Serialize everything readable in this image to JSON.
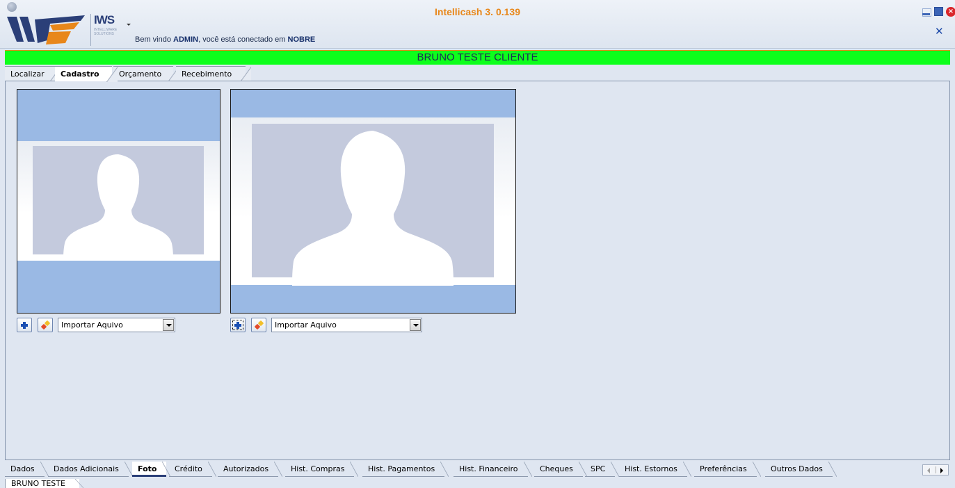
{
  "window": {
    "title": "Intellicash 3. 0.139",
    "close_symbol": "✕",
    "controls": [
      "minimize-icon",
      "maximize-icon",
      "close-icon"
    ]
  },
  "logo": {
    "brand": "IWS",
    "tagline": "INTELLIWARE SOLUTIONS"
  },
  "welcome": {
    "prefix": "Bem vindo ",
    "user": "ADMIN",
    "middle": ", você está conectado em ",
    "location": "NOBRE"
  },
  "banner": {
    "client_name": "BRUNO TESTE CLIENTE"
  },
  "top_tabs": [
    {
      "label": "Localizar"
    },
    {
      "label": "Cadastro",
      "active": true
    },
    {
      "label": "Orçamento"
    },
    {
      "label": "Recebimento"
    }
  ],
  "photo_panels": [
    {
      "select_value": "Importar Aquivo"
    },
    {
      "select_value": "Importar Aquivo"
    }
  ],
  "bottom_tabs": [
    {
      "label": "Dados"
    },
    {
      "label": "Dados Adicionais"
    },
    {
      "label": "Foto",
      "active": true
    },
    {
      "label": "Crédito"
    },
    {
      "label": "Autorizados"
    },
    {
      "label": "Hist. Compras"
    },
    {
      "label": "Hist. Pagamentos"
    },
    {
      "label": "Hist. Financeiro"
    },
    {
      "label": "Cheques"
    },
    {
      "label": "SPC"
    },
    {
      "label": "Hist. Estornos"
    },
    {
      "label": "Preferências"
    },
    {
      "label": "Outros Dados"
    }
  ],
  "status_tab": {
    "label": "BRUNO TESTE"
  },
  "colors": {
    "title": "#e8871a",
    "banner": "#0dff1b",
    "photo_background": "#9ab9e4",
    "silhouette_frame": "#c4cadd"
  }
}
